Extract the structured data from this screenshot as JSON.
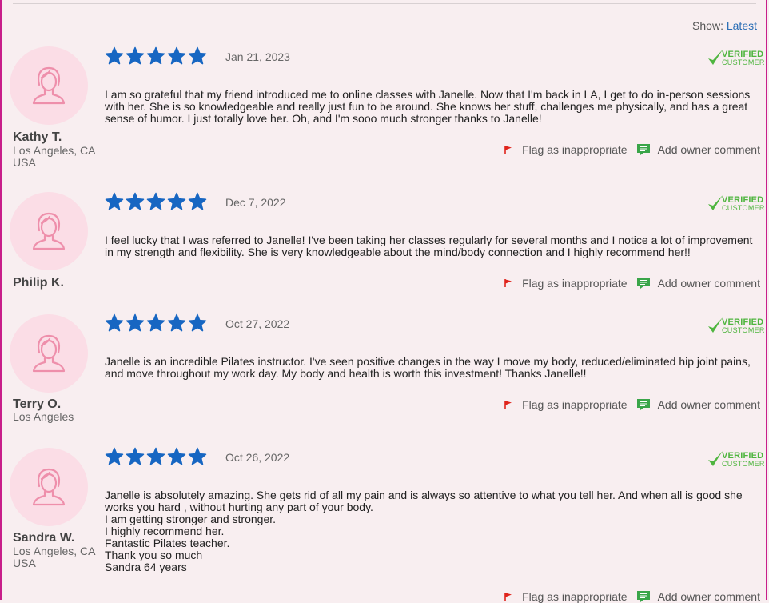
{
  "header": {
    "show_label": "Show:",
    "show_value": "Latest"
  },
  "labels": {
    "verified_top": "VERIFIED",
    "verified_bottom": "CUSTOMER",
    "flag": "Flag as inappropriate",
    "owner_comment": "Add owner comment"
  },
  "colors": {
    "star": "#1766c2",
    "verified": "#4fb53f",
    "flag": "#e0241c",
    "comment": "#3aa549",
    "avatar_bg": "#fbdde6",
    "avatar_stroke": "#ee8fab",
    "link": "#2a6db5"
  },
  "reviews": [
    {
      "name": "Kathy T.",
      "location_lines": [
        "Los Angeles, CA",
        "USA"
      ],
      "rating": 5,
      "date": "Jan 21, 2023",
      "body_lines": [
        "I am so grateful that my friend introduced me to online classes with Janelle. Now that I'm back in LA, I get to do in-person sessions with her. She is so knowledgeable and really just fun to be around. She knows her stuff, challenges me physically, and has a great sense of humor. I just totally love her. Oh, and I'm sooo much stronger thanks to Janelle!"
      ]
    },
    {
      "name": "Philip K.",
      "location_lines": [],
      "rating": 5,
      "date": "Dec 7, 2022",
      "body_lines": [
        "I feel lucky that I was referred to Janelle! I've been taking her classes regularly for several months and I notice a lot of improvement in my strength and flexibility. She is very knowledgeable about the mind/body connection and I highly recommend her!!"
      ]
    },
    {
      "name": "Terry O.",
      "location_lines": [
        "Los Angeles"
      ],
      "rating": 5,
      "date": "Oct 27, 2022",
      "body_lines": [
        "Janelle is an incredible Pilates instructor.  I've seen positive changes in the way I move my body, reduced/eliminated hip joint pains, and move throughout my work day.  My body and health is worth this investment!  Thanks Janelle!!"
      ]
    },
    {
      "name": "Sandra W.",
      "location_lines": [
        "Los Angeles, CA",
        "USA"
      ],
      "rating": 5,
      "date": "Oct 26, 2022",
      "body_lines": [
        "Janelle is absolutely amazing. She gets rid of all my pain and is always so attentive to what you tell her. And when all is good she works you hard , without hurting any part of your body.",
        "I am getting stronger and stronger.",
        "I highly recommend her.",
        "Fantastic Pilates teacher.",
        "Thank you so much",
        "Sandra 64 years"
      ]
    }
  ]
}
